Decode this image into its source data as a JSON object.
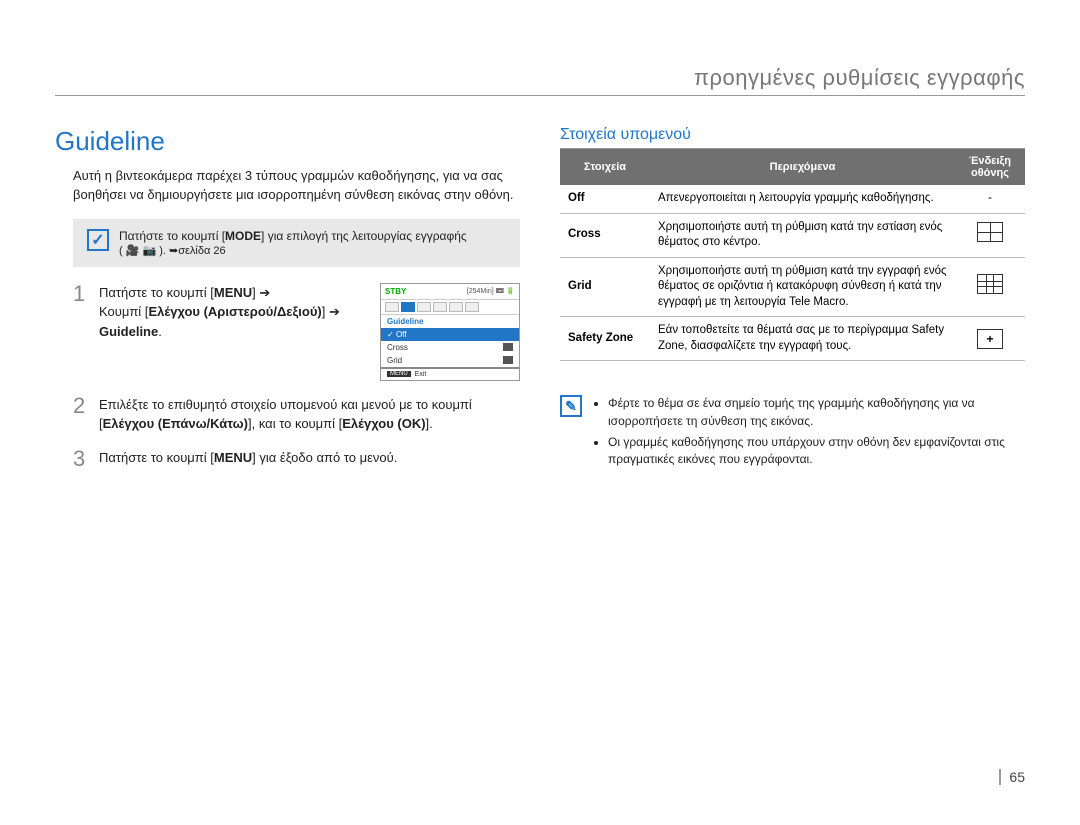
{
  "header": "προηγμένες ρυθμίσεις εγγραφής",
  "left": {
    "title": "Guideline",
    "intro": "Αυτή η βιντεοκάμερα παρέχει 3 τύπους γραμμών καθοδήγησης, για να σας βοηθήσει να δημιουργήσετε μια ισορροπημένη σύνθεση εικόνας στην οθόνη.",
    "note_pre": "Πατήστε το κουμπί [",
    "note_mode": "MODE",
    "note_post": "] για επιλογή της λειτουργίας εγγραφής",
    "note_icons": "( 🎥 📷 ). ➥σελίδα 26",
    "steps": {
      "s1": {
        "num": "1",
        "l1": "Πατήστε το κουμπί [",
        "menu": "MENU",
        "l1b": "] ➔",
        "l2a": "Κουμπί [",
        "l2b": "Ελέγχου (Αριστερού/Δεξιού)",
        "l2c": "] ➔ ",
        "l2d": "Guideline",
        "l2e": "."
      },
      "s2": {
        "num": "2",
        "l1": "Επιλέξτε το επιθυμητό στοιχείο υπομενού και μενού με το κουμπί [",
        "b1": "Ελέγχου (Επάνω/Κάτω)",
        "l2": "], και το κουμπί [",
        "b2": "Ελέγχου (OK)",
        "l3": "]."
      },
      "s3": {
        "num": "3",
        "l1": "Πατήστε το κουμπί [",
        "menu": "MENU",
        "l2": "] για έξοδο από το μενού."
      }
    },
    "lcd": {
      "stby": "STBY",
      "time": "[254Min]",
      "title": "Guideline",
      "off": "Off",
      "cross": "Cross",
      "grid": "Grid",
      "menu": "MENU",
      "exit": "Exit"
    }
  },
  "right": {
    "subtitle": "Στοιχεία υπομενού",
    "table": {
      "head": {
        "c1": "Στοιχεία",
        "c2": "Περιεχόμενα",
        "c3": "Ένδειξη οθόνης"
      },
      "rows": [
        {
          "item": "Off",
          "desc": "Απενεργοποιείται η λειτουργία γραμμής καθοδήγησης.",
          "ind": "-"
        },
        {
          "item": "Cross",
          "desc": "Χρησιμοποιήστε αυτή τη ρύθμιση κατά την εστίαση ενός θέματος στο κέντρο.",
          "ind": "cross"
        },
        {
          "item": "Grid",
          "desc": "Χρησιμοποιήστε αυτή τη ρύθμιση κατά την εγγραφή ενός θέματος σε οριζόντια ή κατακόρυφη σύνθεση ή κατά την εγγραφή με τη λειτουργία Tele Macro.",
          "ind": "grid"
        },
        {
          "item": "Safety Zone",
          "desc": "Εάν τοποθετείτε τα θέματά σας με το περίγραμμα Safety Zone, διασφαλίζετε την εγγραφή τους.",
          "ind": "safe"
        }
      ]
    },
    "tips": [
      "Φέρτε το θέμα σε ένα σημείο τομής της γραμμής καθοδήγησης για να ισορροπήσετε τη σύνθεση της εικόνας.",
      "Οι γραμμές καθοδήγησης που υπάρχουν στην οθόνη δεν εμφανίζονται στις πραγματικές εικόνες που εγγράφονται."
    ]
  },
  "page_number": "65"
}
